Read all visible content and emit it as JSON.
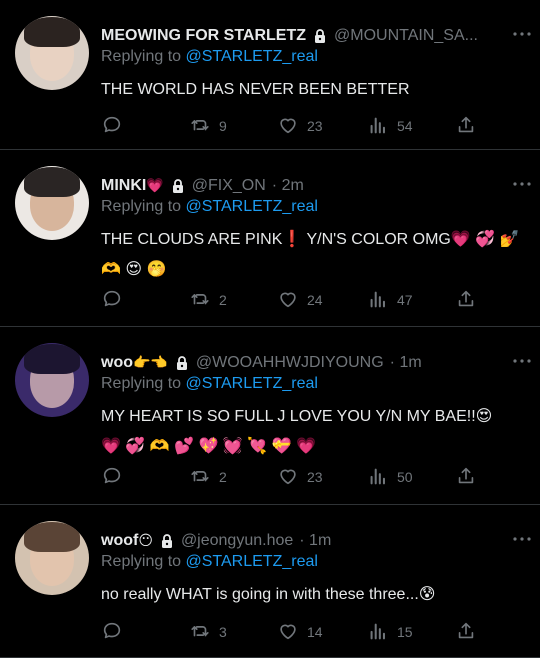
{
  "tweets": [
    {
      "name": "MEOWING FOR STARLETZ",
      "name_emoji": "",
      "handle": "@MOUNTAIN_SA...",
      "time": "",
      "replying_prefix": "Replying to ",
      "replying_to": "@STARLETZ_real",
      "text": "THE WORLD HAS NEVER BEEN BETTER",
      "text_line2": "",
      "retweets": "9",
      "likes": "23",
      "views": "54",
      "avatar": {
        "bg": "#d9cfc6",
        "face": "#e8d2c2",
        "hair": "#2b2320"
      }
    },
    {
      "name": "MINKI",
      "name_emoji": "💗",
      "handle": "@FIX_ON",
      "time": "· 2m",
      "replying_prefix": "Replying to ",
      "replying_to": "@STARLETZ_real",
      "text": "THE CLOUDS ARE PINK❗ Y/N'S COLOR OMG💗 💞 💅",
      "text_line2": "🫶 😍 🤭",
      "retweets": "2",
      "likes": "24",
      "views": "47",
      "avatar": {
        "bg": "#ece8e4",
        "face": "#d7b59c",
        "hair": "#2a2524"
      }
    },
    {
      "name": "woo",
      "name_emoji": "👉👈",
      "handle": "@WOOAHHWJDIYOUNG",
      "time": "· 1m",
      "replying_prefix": "Replying to ",
      "replying_to": "@STARLETZ_real",
      "text": "MY HEART IS SO FULL J LOVE YOU Y/N MY BAE!!😍",
      "text_line2": "💗 💞 🫶 💕 💖 💓 💘 💝 💗",
      "retweets": "2",
      "likes": "23",
      "views": "50",
      "avatar": {
        "bg": "#3a2a6a",
        "face": "#b79aa8",
        "hair": "#1c1530"
      }
    },
    {
      "name": "woof",
      "name_emoji": "😶",
      "handle": "@jeongyun.hoe",
      "time": "· 1m",
      "replying_prefix": "Replying to ",
      "replying_to": "@STARLETZ_real",
      "text": "no really WHAT is going in with these three...😰",
      "text_line2": "",
      "retweets": "3",
      "likes": "14",
      "views": "15",
      "avatar": {
        "bg": "#d3c2b0",
        "face": "#e2c4ad",
        "hair": "#5a4436"
      }
    }
  ],
  "colors": {
    "background": "#000000",
    "text": "#e7e9ea",
    "muted": "#71767b",
    "mention": "#1d9bf0",
    "divider": "#2f3336"
  },
  "icons": [
    "lock-icon",
    "more-icon",
    "reply-icon",
    "retweet-icon",
    "like-icon",
    "views-icon",
    "share-icon"
  ]
}
